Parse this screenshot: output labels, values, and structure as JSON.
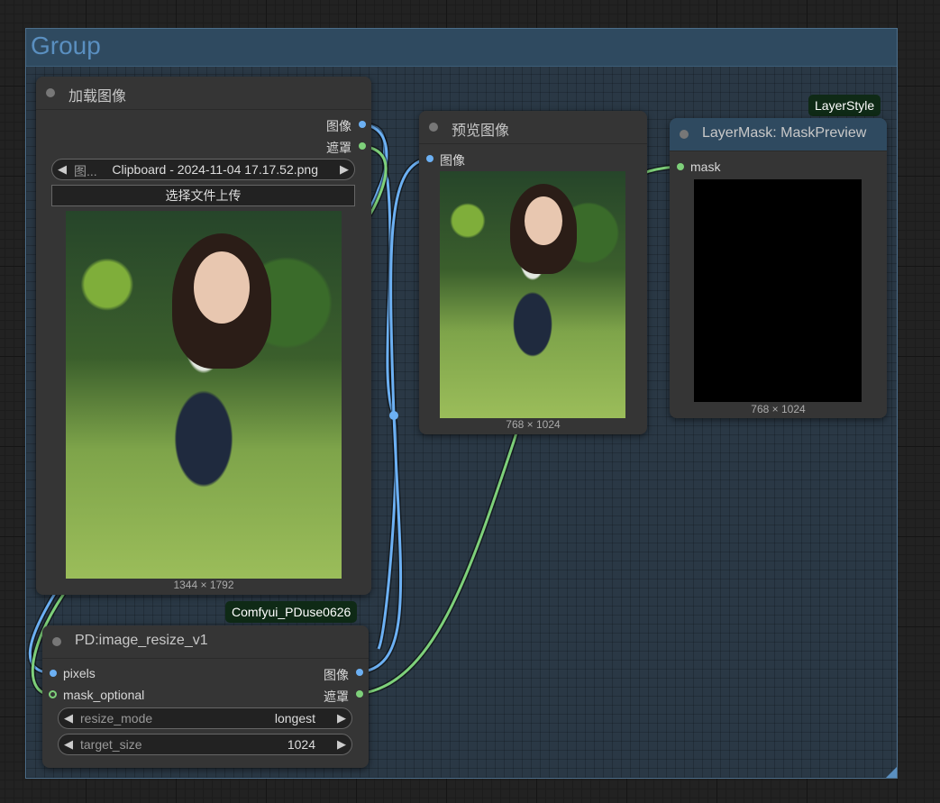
{
  "group": {
    "title": "Group"
  },
  "load_image_node": {
    "title": "加载图像",
    "outputs": [
      {
        "label": "图像",
        "type": "IMAGE",
        "color": "#6cb0f3"
      },
      {
        "label": "遮罩",
        "type": "MASK",
        "color": "#7ed07a"
      }
    ],
    "image_widget": {
      "label": "图...",
      "value": "Clipboard - 2024-11-04 17.17.52.png"
    },
    "upload_button": "选择文件上传",
    "image_dims": "1344 × 1792"
  },
  "preview_node": {
    "title": "预览图像",
    "input_label": "图像",
    "image_dims": "768 × 1024"
  },
  "mask_preview_node": {
    "badge": "LayerStyle",
    "title": "LayerMask: MaskPreview",
    "input_label": "mask",
    "image_dims": "768 × 1024"
  },
  "resize_node": {
    "badge": "Comfyui_PDuse0626",
    "title": "PD:image_resize_v1",
    "inputs": [
      "pixels",
      "mask_optional"
    ],
    "outputs": [
      "图像",
      "遮罩"
    ],
    "widgets": [
      {
        "label": "resize_mode",
        "value": "longest"
      },
      {
        "label": "target_size",
        "value": "1024"
      }
    ]
  },
  "colors": {
    "image_link": "#6cb0f3",
    "mask_link": "#7ed07a",
    "group_header": "#2f4a60",
    "group_title": "#5a8fc0",
    "badge_bg": "#0f2a16"
  }
}
